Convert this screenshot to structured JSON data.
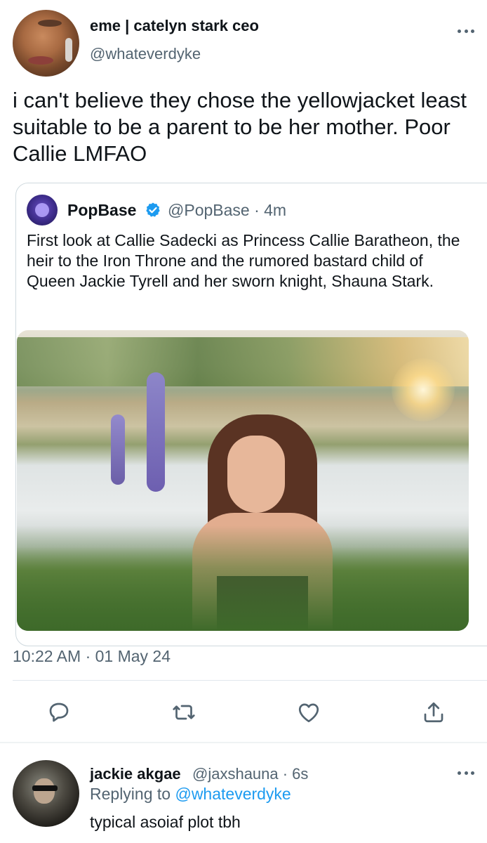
{
  "tweet": {
    "display_name": "eme | catelyn stark ceo",
    "handle": "@whateverdyke",
    "text": "i can't believe they chose the yellowjacket least suitable to be a parent to be her mother. Poor Callie LMFAO",
    "timestamp": "10:22 AM · 01 May 24"
  },
  "quote": {
    "name": "PopBase",
    "handle_time": "@PopBase · 4m",
    "verified": true,
    "text": "First look at Callie Sadecki as Princess Callie Baratheon, the heir to the Iron Throne and the rumored bastard child of Queen Jackie Tyrell and her sworn knight, Shauna Stark."
  },
  "actions": [
    "reply-icon",
    "retweet-icon",
    "like-icon",
    "share-icon"
  ],
  "reply": {
    "display_name": "jackie akgae",
    "handle_time": "@jaxshauna · 6s",
    "replying_prefix": "Replying to",
    "replying_to": "@whateverdyke",
    "text": "typical asoiaf plot tbh"
  },
  "colors": {
    "text": "#0f1419",
    "secondary": "#536471",
    "accent": "#1d9bf0",
    "border": "#cfd9de"
  }
}
